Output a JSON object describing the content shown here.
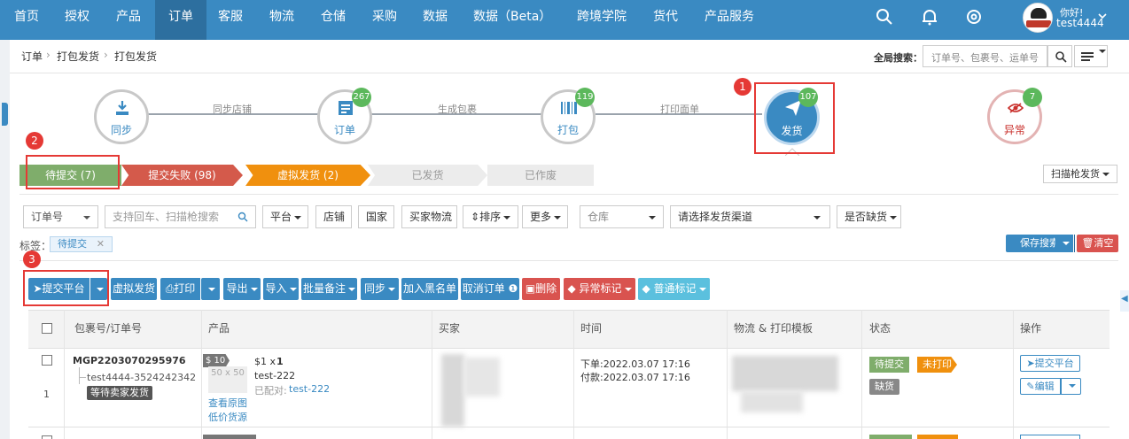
{
  "nav": {
    "items": [
      "首页",
      "授权",
      "产品",
      "订单",
      "客服",
      "物流",
      "仓储",
      "采购",
      "数据",
      "数据（Beta）",
      "跨境学院",
      "货代",
      "产品服务"
    ],
    "active": "订单",
    "user_greeting": "你好!",
    "user_name": "test4444"
  },
  "breadcrumb": {
    "crumbs": [
      "订单",
      "打包发货",
      "打包发货"
    ],
    "global_search_label": "全局搜索：",
    "global_search_placeholder": "订单号、包裹号、运单号"
  },
  "workflow": {
    "steps": [
      {
        "label": "同步",
        "count": ""
      },
      {
        "label": "订单",
        "count": "267"
      },
      {
        "label": "打包",
        "count": "119"
      },
      {
        "label": "发货",
        "count": "107"
      },
      {
        "label": "异常",
        "count": "7"
      }
    ],
    "connectors": [
      "同步店铺",
      "生成包裹",
      "打印面单"
    ]
  },
  "annotations": {
    "n1": "1",
    "n2": "2",
    "n3": "3"
  },
  "status_tabs": [
    "待提交 (7)",
    "提交失败 (98)",
    "虚拟发货 (2)",
    "已发货",
    "已作废"
  ],
  "scan_ship_label": "扫描枪发货",
  "filters": {
    "order_no": "订单号",
    "search_placeholder": "支持回车、扫描枪搜索",
    "platform": "平台",
    "shop": "店铺",
    "country": "国家",
    "buyer_logistics": "买家物流",
    "sort": "排序",
    "more": "更多",
    "warehouse": "仓库",
    "channel": "请选择发货渠道",
    "out_of_stock": "是否缺货",
    "tag_label": "标签：",
    "tag_value": "待提交",
    "save_search": "保存搜索",
    "clear": "清空"
  },
  "toolbar": [
    "提交平台",
    "虚拟发货",
    "打印",
    "导出",
    "导入",
    "批量备注",
    "同步",
    "加入黑名单",
    "取消订单",
    "删除",
    "异常标记",
    "普通标记"
  ],
  "table": {
    "headers": [
      "包裹号/订单号",
      "产品",
      "买家",
      "时间",
      "物流 & 打印模板",
      "状态",
      "操作"
    ],
    "row": {
      "package_no": "MGP2203070295976",
      "order_no": "test4444-3524242342",
      "index": "1",
      "wait_label": "等待卖家发货",
      "price_tag": "$ 10",
      "thumb_size": "50 x 50",
      "unit_line": "$1 x",
      "qty": "1",
      "sku": "test-222",
      "matched_label": "已配对:",
      "matched_sku": "test-222",
      "view_image": "查看原图",
      "low_price": "低价货源",
      "order_time": "下单:2022.03.07 17:16",
      "pay_time": "付款:2022.03.07 17:16",
      "status_pending": "待提交",
      "status_unprinted": "未打印",
      "status_short": "缺货",
      "op_submit": "提交平台",
      "op_edit": "编辑"
    }
  },
  "colors": {
    "nav": "#3a8ac2",
    "green": "#7fad6b",
    "red": "#d9534f",
    "orange": "#f0900e",
    "annotation": "#e53935"
  }
}
